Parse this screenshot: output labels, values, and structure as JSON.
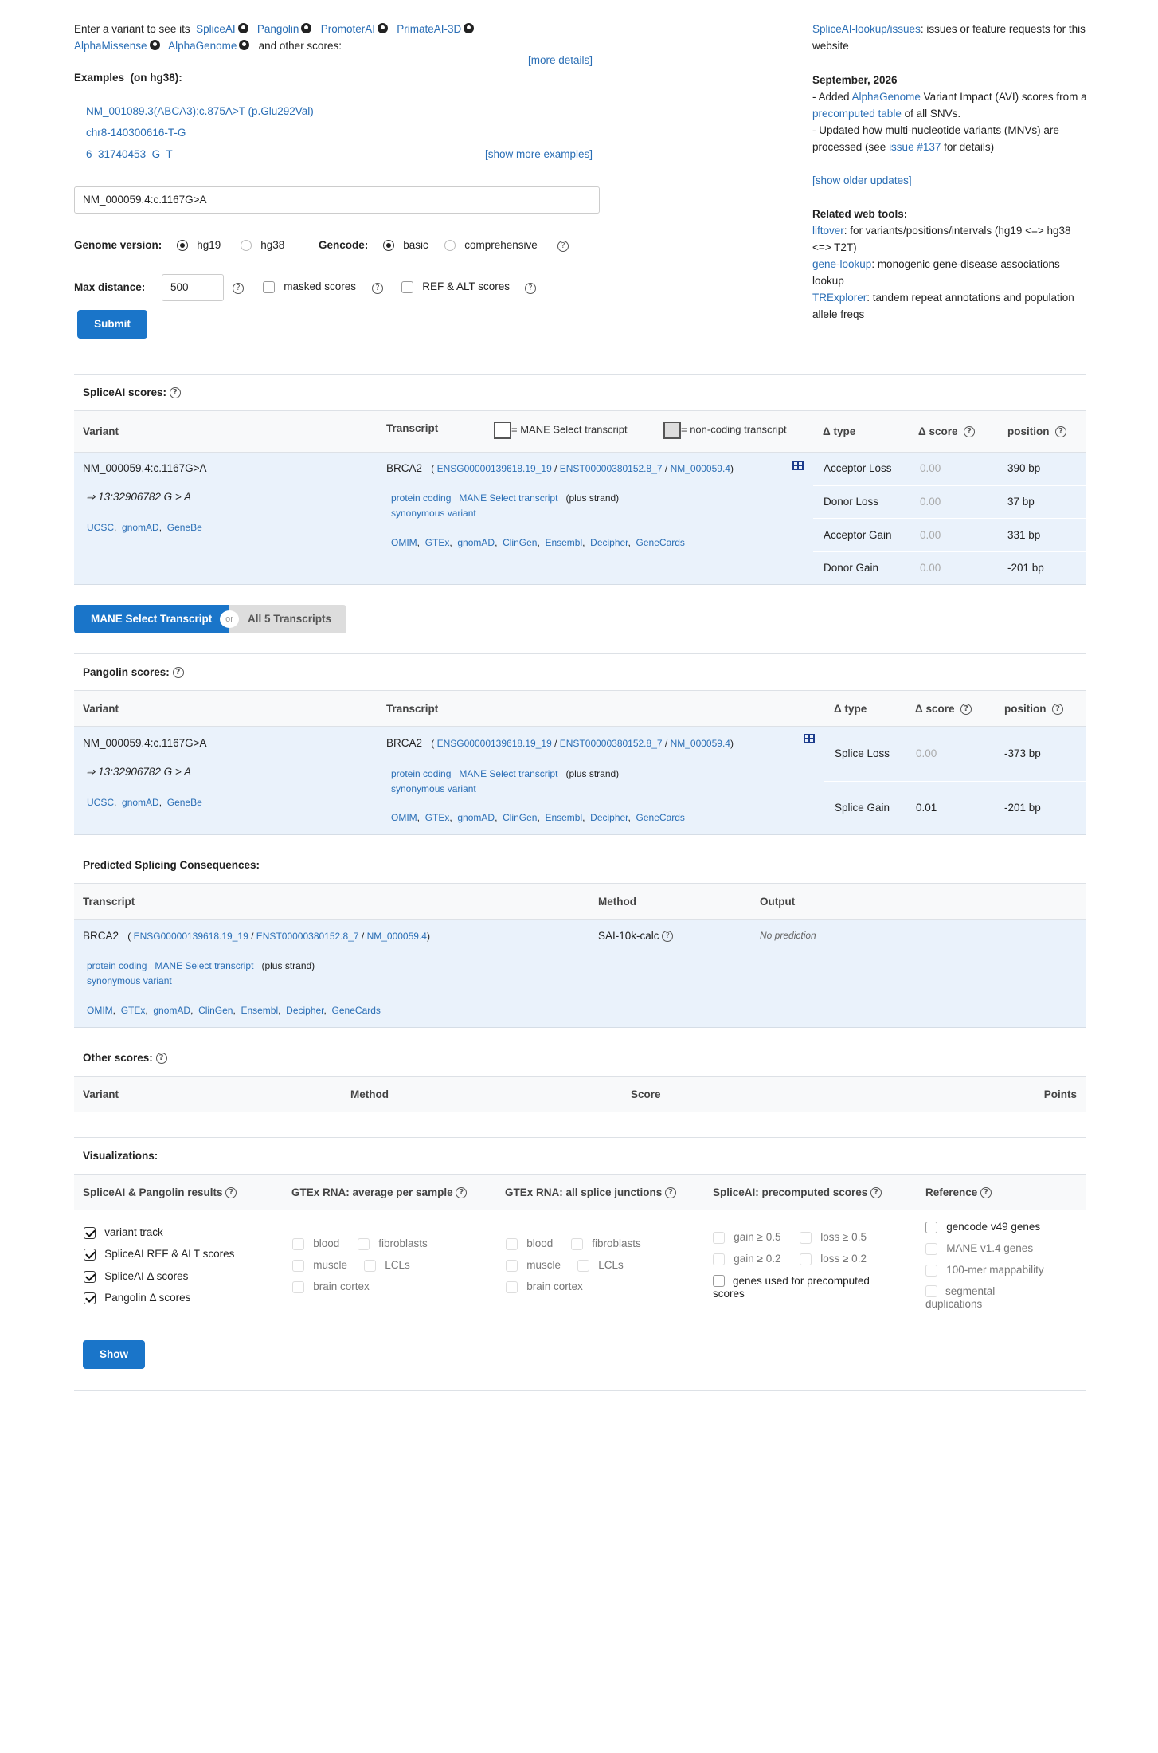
{
  "intro": {
    "prefix": "Enter a variant to see its",
    "links": [
      "SpliceAI",
      "Pangolin",
      "PromoterAI",
      "PrimateAI-3D",
      "AlphaMissense",
      "AlphaGenome"
    ],
    "suffix": "and other scores:",
    "more_details": "[more details]"
  },
  "examples": {
    "title": "Examples",
    "subtitle": "(on hg38):",
    "items": [
      "NM_001089.3(ABCA3):c.875A>T (p.Glu292Val)",
      "chr8-140300616-T-G",
      "6  31740453  G  T"
    ],
    "show_more": "[show more examples]"
  },
  "search": {
    "value": "NM_000059.4:c.1167G>A"
  },
  "genome": {
    "label": "Genome version:",
    "options": [
      "hg19",
      "hg38"
    ],
    "selected": "hg19"
  },
  "gencode": {
    "label": "Gencode:",
    "options": [
      "basic",
      "comprehensive"
    ],
    "selected": "basic"
  },
  "maxdist": {
    "label": "Max distance:",
    "value": "500",
    "masked": "masked scores",
    "refalt": "REF & ALT scores"
  },
  "submit": "Submit",
  "news": {
    "issues_link": "SpliceAI-lookup/issues",
    "issues_text": ": issues or feature requests for this website",
    "date": "September, 2026",
    "l1a": "- Added ",
    "l1link": "AlphaGenome",
    "l1b": " Variant Impact (AVI) scores from a ",
    "l1link2": "precomputed table",
    "l1c": " of all SNVs.",
    "l2a": "- Updated how multi-nucleotide variants (MNVs) are processed (see ",
    "l2link": "issue #137",
    "l2b": " for details)",
    "older": "[show older updates]",
    "related_title": "Related web tools:",
    "tools": [
      {
        "name": "liftover",
        "desc": ": for variants/positions/intervals (hg19 <=> hg38 <=> T2T)"
      },
      {
        "name": "gene-lookup",
        "desc": ": monogenic gene-disease associations lookup"
      },
      {
        "name": "TRExplorer",
        "desc": ": tandem repeat annotations and population allele freqs"
      }
    ]
  },
  "variant": {
    "name": "NM_000059.4:c.1167G>A",
    "coord": "⇒ 13:32906782 G > A",
    "links": [
      "UCSC",
      "gnomAD",
      "GeneBe"
    ]
  },
  "transcript": {
    "gene": "BRCA2",
    "ensg": "ENSG00000139618.19_19",
    "enst": "ENST00000380152.8_7",
    "nm": "NM_000059.4",
    "tags": [
      "protein coding",
      "MANE Select transcript"
    ],
    "strand": "(plus strand)",
    "consequence": "synonymous variant",
    "links": [
      "OMIM",
      "GTEx",
      "gnomAD",
      "ClinGen",
      "Ensembl",
      "Decipher",
      "GeneCards"
    ]
  },
  "spliceai": {
    "title": "SpliceAI scores:",
    "headers": {
      "variant": "Variant",
      "transcript": "Transcript",
      "mane_legend": "= MANE Select transcript",
      "noncoding_legend": "= non-coding transcript",
      "dtype": "Δ type",
      "dscore": "Δ score",
      "position": "position"
    },
    "rows": [
      {
        "type": "Acceptor Loss",
        "score": "0.00",
        "pos": "390 bp"
      },
      {
        "type": "Donor Loss",
        "score": "0.00",
        "pos": "37 bp"
      },
      {
        "type": "Acceptor Gain",
        "score": "0.00",
        "pos": "331 bp"
      },
      {
        "type": "Donor Gain",
        "score": "0.00",
        "pos": "-201 bp"
      }
    ]
  },
  "toggle": {
    "left": "MANE Select Transcript",
    "or": "or",
    "right": "All 5 Transcripts"
  },
  "pangolin": {
    "title": "Pangolin scores:",
    "rows": [
      {
        "type": "Splice Loss",
        "score": "0.00",
        "pos": "-373 bp"
      },
      {
        "type": "Splice Gain",
        "score": "0.01",
        "pos": "-201 bp"
      }
    ]
  },
  "consequences": {
    "title": "Predicted Splicing Consequences:",
    "headers": [
      "Transcript",
      "Method",
      "Output"
    ],
    "method": "SAI-10k-calc",
    "output": "No prediction"
  },
  "other": {
    "title": "Other scores:",
    "headers": [
      "Variant",
      "Method",
      "Score",
      "Points"
    ]
  },
  "viz": {
    "title": "Visualizations:",
    "cols": {
      "c1": "SpliceAI & Pangolin results",
      "c2": "GTEx RNA: average per sample",
      "c3": "GTEx RNA: all splice junctions",
      "c4": "SpliceAI: precomputed scores",
      "c5": "Reference"
    },
    "c1items": [
      "variant track",
      "SpliceAI REF & ALT scores",
      "SpliceAI Δ  scores",
      "Pangolin Δ  scores"
    ],
    "gtex": [
      "blood",
      "fibroblasts",
      "muscle",
      "LCLs",
      "brain cortex"
    ],
    "pre": [
      "gain ≥ 0.5",
      "loss ≥ 0.5",
      "gain ≥ 0.2",
      "loss ≥ 0.2",
      "genes used for precomputed scores"
    ],
    "ref": [
      "gencode v49 genes",
      "MANE v1.4 genes",
      "100-mer mappability",
      "segmental duplications"
    ],
    "show": "Show"
  }
}
